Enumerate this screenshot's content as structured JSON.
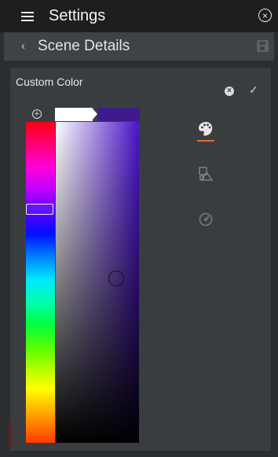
{
  "header": {
    "title": "Settings"
  },
  "subheader": {
    "title": "Scene Details"
  },
  "panel": {
    "title": "Custom Color"
  },
  "colors": {
    "accent": "#e86b23",
    "previous_color": "#ffffff",
    "selected_color": "#3f1a8c"
  },
  "icons": {
    "menu": "hamburger-icon",
    "close": "close-circle-icon",
    "back": "chevron-left-icon",
    "save": "save-icon",
    "cancel": "cancel-icon",
    "confirm": "check-icon",
    "add": "add-circle-icon",
    "tabs": [
      "palette-icon",
      "shapes-icon",
      "dial-icon"
    ]
  }
}
